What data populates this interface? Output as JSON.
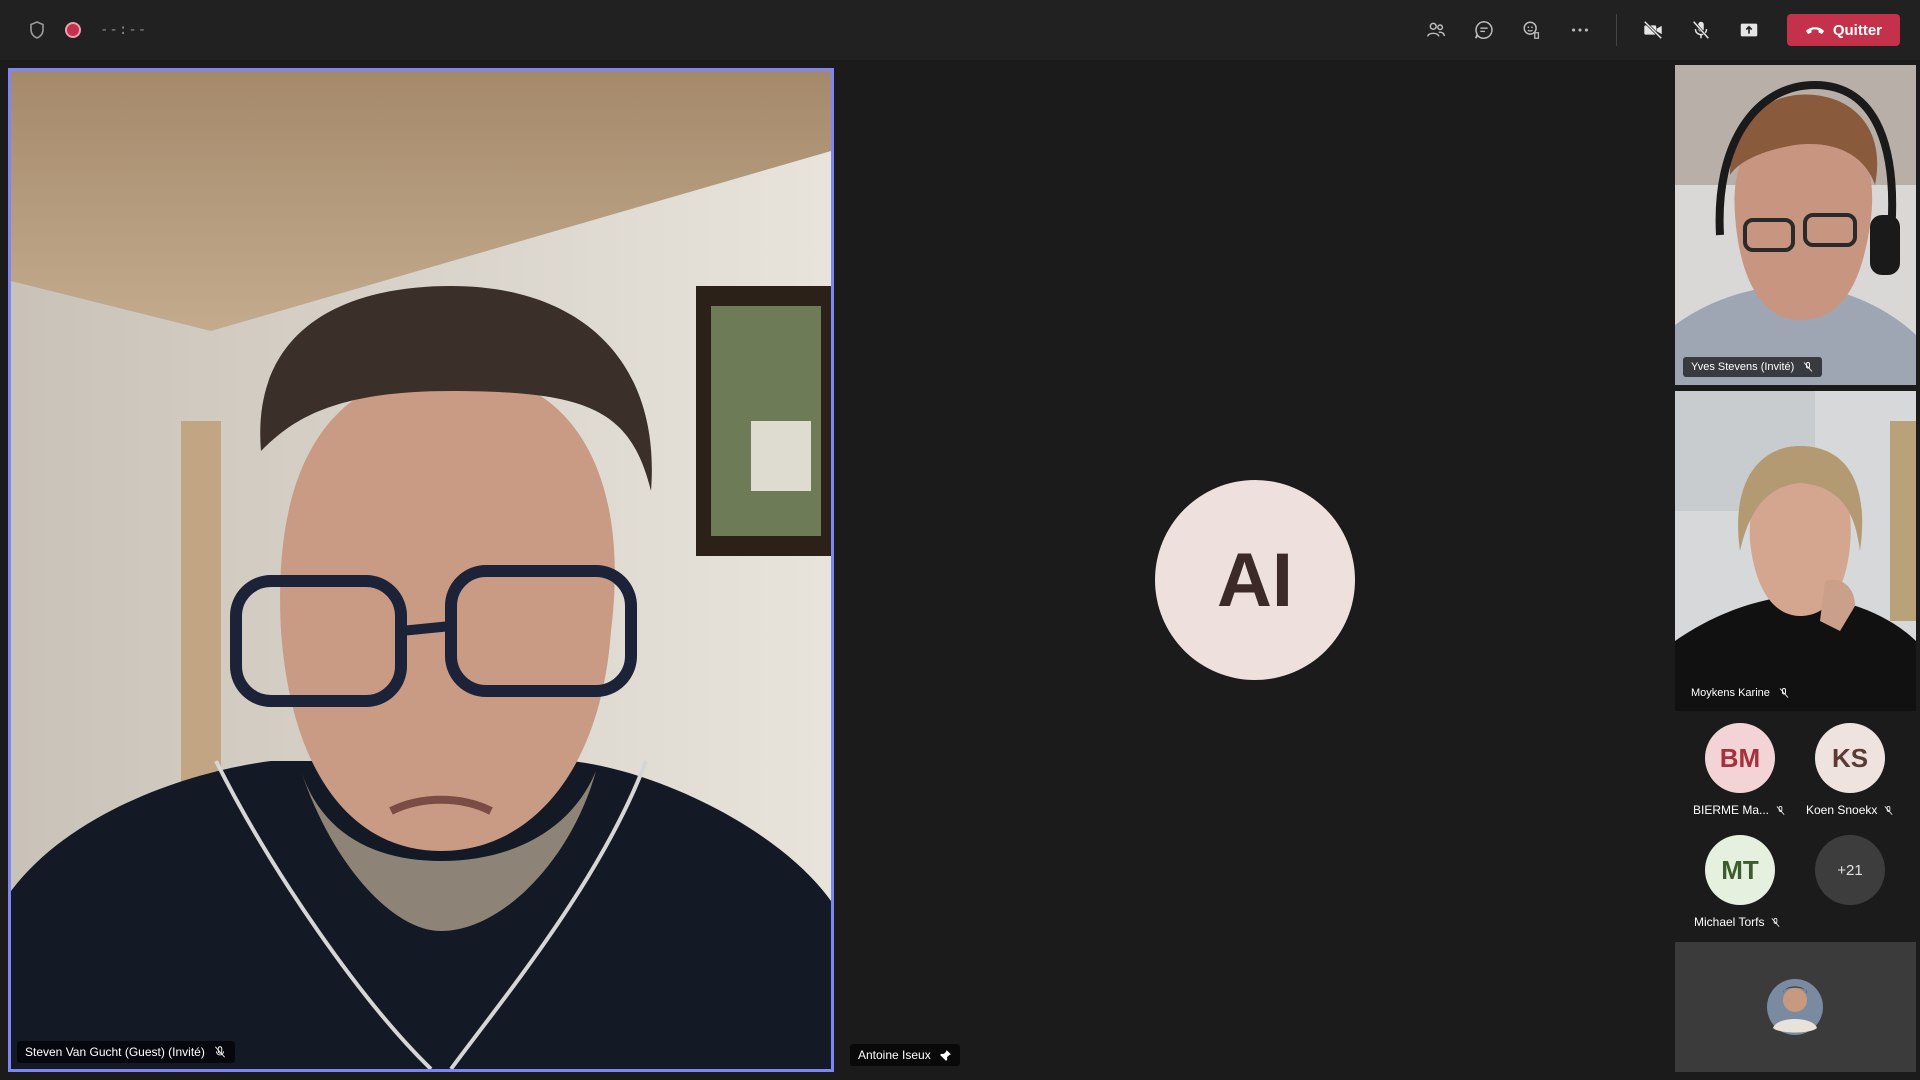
{
  "topbar": {
    "timer": "--:--",
    "quit_label": "Quitter"
  },
  "main_participant": {
    "name": "Steven Van Gucht (Guest) (Invité)"
  },
  "focused_participant": {
    "initials": "AI",
    "name": "Antoine Iseux"
  },
  "side_videos": [
    {
      "name": "Yves Stevens (Invité)"
    },
    {
      "name": "Moykens Karine"
    }
  ],
  "gallery": [
    {
      "initials": "BM",
      "name": "BIERME Ma...",
      "bg": "#f4d3d6",
      "fg": "#a3323d"
    },
    {
      "initials": "KS",
      "name": "Koen Snoekx",
      "bg": "#efe3e0",
      "fg": "#5a3b36"
    },
    {
      "initials": "MT",
      "name": "Michael Torfs",
      "bg": "#e6f0df",
      "fg": "#3e5b2e"
    }
  ],
  "overflow_count": "+21",
  "colors": {
    "accent": "#7f85f5",
    "quit": "#c4314b",
    "background": "#1b1b1b"
  }
}
